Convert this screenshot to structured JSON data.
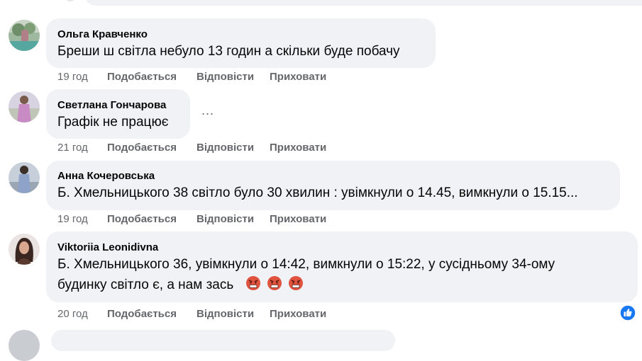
{
  "comments": [
    {
      "author": "Ольга Кравченко",
      "lines": [
        "Бреши ш світла небуло 13 годин а скільки буде побачу"
      ],
      "time": "19 год",
      "like_label": "Подобається",
      "reply_label": "Відповісти",
      "hide_label": "Приховати"
    },
    {
      "author": "Светлана Гончарова",
      "lines": [
        "Графік не працює"
      ],
      "time": "21 год",
      "like_label": "Подобається",
      "reply_label": "Відповісти",
      "hide_label": "Приховати",
      "more_label": "..."
    },
    {
      "author": "Анна Кочеровська",
      "lines": [
        "Б. Хмельницького 38 світло було 30 хвилин : увімкнули о 14.45, вимкнули о 15.15..."
      ],
      "time": "19 год",
      "like_label": "Подобається",
      "reply_label": "Відповісти",
      "hide_label": "Приховати"
    },
    {
      "author": "Viktoriia Leonidivna",
      "lines": [
        "Б. Хмельницького 36, увімкнули о 14:42, вимкнули о 15:22, у сусідньому 34-ому",
        "будинку світло є, а нам зась"
      ],
      "emoji": [
        "angry-face-emoji",
        "angry-face-emoji",
        "angry-face-emoji"
      ],
      "time": "20 год",
      "like_label": "Подобається",
      "reply_label": "Відповісти",
      "hide_label": "Приховати",
      "reaction_icon": "like-thumb-icon"
    }
  ],
  "colors": {
    "bubble": "#f0f2f5",
    "meta_text": "#65676b",
    "like_blue": "#1877f2",
    "emoji_red": "#e0533e"
  }
}
